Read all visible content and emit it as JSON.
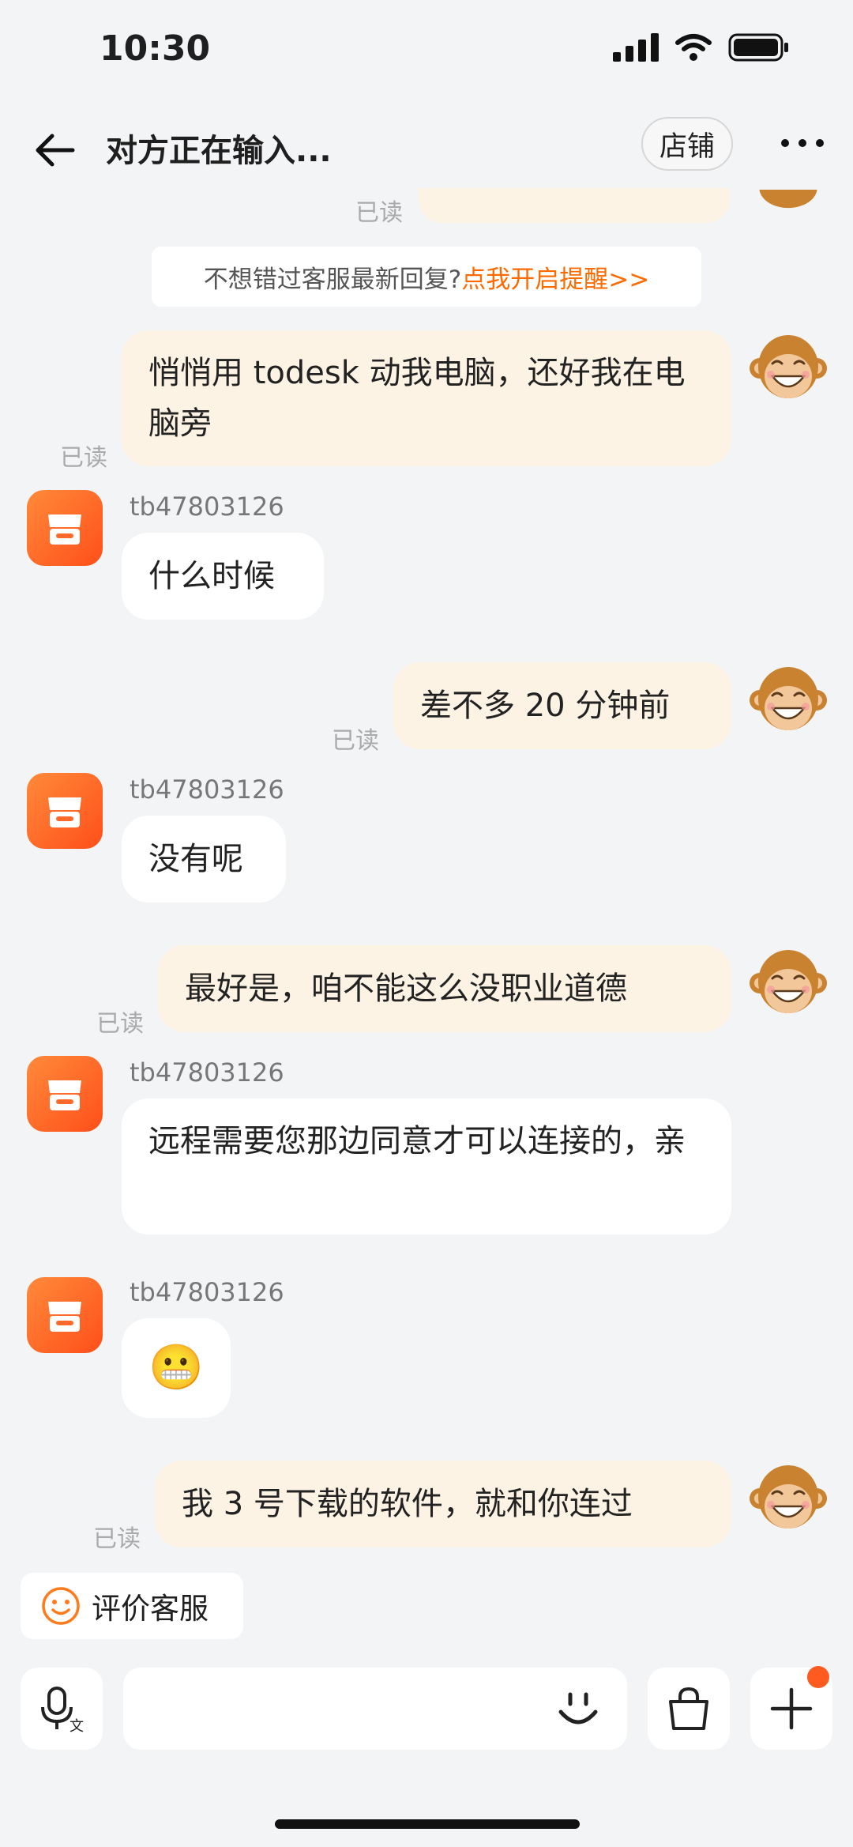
{
  "status_bar": {
    "time": "10:30"
  },
  "header": {
    "title": "对方正在输入...",
    "shop_button": "店铺"
  },
  "partial_top": {
    "read": "已读"
  },
  "notice": {
    "text": "不想错过客服最新回复?",
    "link": "点我开启提醒>>"
  },
  "messages": [
    {
      "side": "out",
      "text": "悄悄用 todesk 动我电脑，还好我在电脑旁",
      "read": "已读"
    },
    {
      "side": "in",
      "sender": "tb47803126",
      "text": "什么时候"
    },
    {
      "side": "out",
      "text": "差不多 20 分钟前",
      "read": "已读"
    },
    {
      "side": "in",
      "sender": "tb47803126",
      "text": "没有呢"
    },
    {
      "side": "out",
      "text": "最好是，咱不能这么没职业道德",
      "read": "已读"
    },
    {
      "side": "in",
      "sender": "tb47803126",
      "text": "远程需要您那边同意才可以连接的，亲"
    },
    {
      "side": "in",
      "sender": "tb47803126",
      "text": "😬"
    },
    {
      "side": "out",
      "text": "我 3 号下载的软件，就和你连过",
      "read": "已读"
    }
  ],
  "bottom": {
    "rate_button": "评价客服"
  },
  "icons": {
    "back": "back-arrow-icon",
    "more": "more-icon",
    "voice": "voice-translate-icon",
    "emoji": "emoji-icon",
    "bag": "shopping-bag-icon",
    "plus": "plus-icon",
    "shop_avatar": "shop-store-icon",
    "user_avatar": "monkey-avatar-icon"
  },
  "colors": {
    "accent": "#ff6a00",
    "out_bubble": "#fdf3e4",
    "background": "#f3f4f6"
  }
}
